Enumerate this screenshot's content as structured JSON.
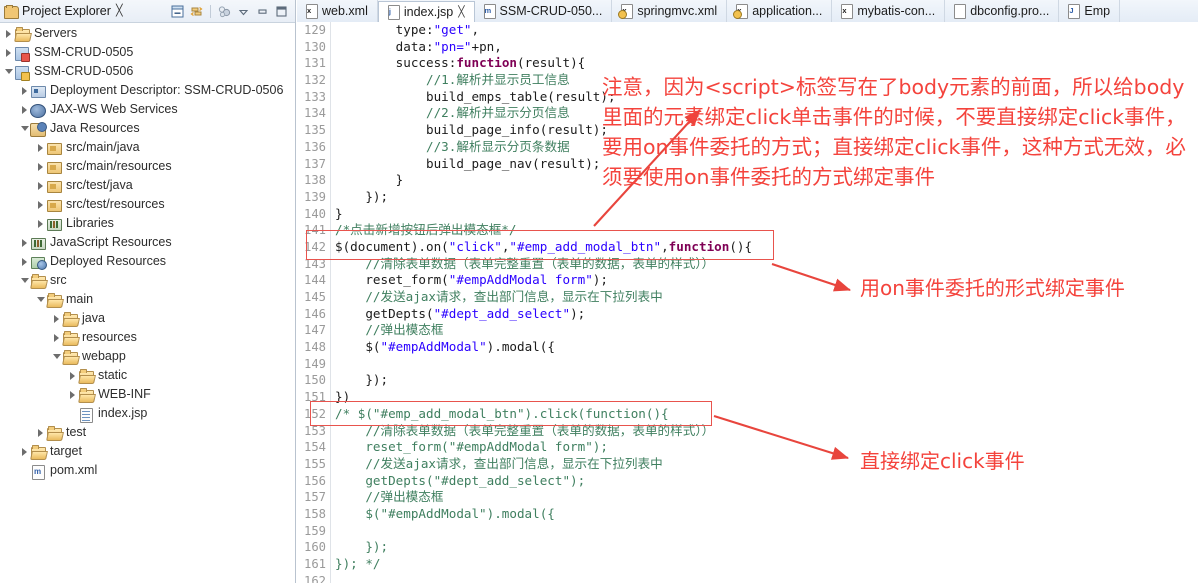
{
  "explorer": {
    "title": "Project Explorer",
    "close_glyph": "╳",
    "view_icon": "project-explorer-icon",
    "tools": [
      {
        "name": "collapse-all-icon",
        "label": "Collapse All"
      },
      {
        "name": "link-with-editor-icon",
        "label": "Link with Editor"
      },
      {
        "name": "focus-on-active-task-icon",
        "label": "Focus on Active Task"
      },
      {
        "name": "view-menu-icon",
        "label": "View Menu"
      },
      {
        "name": "minimize-icon",
        "label": "Minimize"
      },
      {
        "name": "maximize-icon",
        "label": "Maximize"
      }
    ],
    "tree": [
      {
        "label": "Servers",
        "indent": 0,
        "state": "closed",
        "icon": "folder-open-icon"
      },
      {
        "label": "SSM-CRUD-0505",
        "indent": 0,
        "state": "closed",
        "icon": "project-error-icon"
      },
      {
        "label": "SSM-CRUD-0506",
        "indent": 0,
        "state": "open",
        "icon": "project-warning-icon"
      },
      {
        "label": "Deployment Descriptor: SSM-CRUD-0506",
        "indent": 1,
        "state": "closed",
        "icon": "deployment-descriptor-icon"
      },
      {
        "label": "JAX-WS Web Services",
        "indent": 1,
        "state": "closed",
        "icon": "web-services-icon"
      },
      {
        "label": "Java Resources",
        "indent": 1,
        "state": "open",
        "icon": "java-resources-icon"
      },
      {
        "label": "src/main/java",
        "indent": 2,
        "state": "closed",
        "icon": "source-folder-icon"
      },
      {
        "label": "src/main/resources",
        "indent": 2,
        "state": "closed",
        "icon": "source-folder-icon"
      },
      {
        "label": "src/test/java",
        "indent": 2,
        "state": "closed",
        "icon": "source-folder-icon"
      },
      {
        "label": "src/test/resources",
        "indent": 2,
        "state": "closed",
        "icon": "source-folder-icon"
      },
      {
        "label": "Libraries",
        "indent": 2,
        "state": "closed",
        "icon": "libraries-icon"
      },
      {
        "label": "JavaScript Resources",
        "indent": 1,
        "state": "closed",
        "icon": "libraries-icon"
      },
      {
        "label": "Deployed Resources",
        "indent": 1,
        "state": "closed",
        "icon": "deployed-resources-icon"
      },
      {
        "label": "src",
        "indent": 1,
        "state": "open",
        "icon": "folder-open-icon"
      },
      {
        "label": "main",
        "indent": 2,
        "state": "open",
        "icon": "folder-open-icon"
      },
      {
        "label": "java",
        "indent": 3,
        "state": "closed",
        "icon": "folder-open-icon"
      },
      {
        "label": "resources",
        "indent": 3,
        "state": "closed",
        "icon": "folder-open-icon"
      },
      {
        "label": "webapp",
        "indent": 3,
        "state": "open",
        "icon": "folder-open-icon"
      },
      {
        "label": "static",
        "indent": 4,
        "state": "closed",
        "icon": "folder-open-icon"
      },
      {
        "label": "WEB-INF",
        "indent": 4,
        "state": "closed",
        "icon": "folder-open-icon"
      },
      {
        "label": "index.jsp",
        "indent": 4,
        "state": "leaf",
        "icon": "jsp-file-icon"
      },
      {
        "label": "test",
        "indent": 2,
        "state": "closed",
        "icon": "folder-open-icon"
      },
      {
        "label": "target",
        "indent": 1,
        "state": "closed",
        "icon": "folder-open-icon"
      },
      {
        "label": "pom.xml",
        "indent": 1,
        "state": "leaf",
        "icon": "maven-pom-icon"
      }
    ]
  },
  "editor": {
    "tabs": [
      {
        "label": "web.xml",
        "icon": "xml-file-icon",
        "badge": "x",
        "active": false,
        "closable": false,
        "warn": false
      },
      {
        "label": "index.jsp",
        "icon": "jsp-file-icon",
        "badge": "j",
        "active": true,
        "closable": true,
        "warn": false,
        "close_glyph": "╳"
      },
      {
        "label": "SSM-CRUD-050...",
        "icon": "maven-pom-icon",
        "badge": "m",
        "active": false,
        "closable": false,
        "warn": false
      },
      {
        "label": "springmvc.xml",
        "icon": "xml-file-icon",
        "badge": "x",
        "active": false,
        "closable": false,
        "warn": true
      },
      {
        "label": "application...",
        "icon": "xml-file-icon",
        "badge": "x",
        "active": false,
        "closable": false,
        "warn": true
      },
      {
        "label": "mybatis-con...",
        "icon": "xml-file-icon",
        "badge": "x",
        "active": false,
        "closable": false,
        "warn": false
      },
      {
        "label": "dbconfig.pro...",
        "icon": "properties-file-icon",
        "badge": "",
        "active": false,
        "closable": false,
        "warn": false
      },
      {
        "label": "Emp",
        "icon": "java-file-icon",
        "badge": "J",
        "active": false,
        "closable": false,
        "warn": false
      }
    ],
    "first_line_number": 129,
    "lines": [
      {
        "n": 129,
        "tokens": [
          {
            "t": "        type:",
            "c": "def"
          },
          {
            "t": "\"get\"",
            "c": "str"
          },
          {
            "t": ",",
            "c": "def"
          }
        ]
      },
      {
        "n": 130,
        "tokens": [
          {
            "t": "        data:",
            "c": "def"
          },
          {
            "t": "\"pn=\"",
            "c": "str"
          },
          {
            "t": "+pn,",
            "c": "def"
          }
        ]
      },
      {
        "n": 131,
        "tokens": [
          {
            "t": "        success:",
            "c": "def"
          },
          {
            "t": "function",
            "c": "kw"
          },
          {
            "t": "(result){",
            "c": "def"
          }
        ]
      },
      {
        "n": 132,
        "tokens": [
          {
            "t": "            //1.解析并显示员工信息",
            "c": "cmt"
          }
        ]
      },
      {
        "n": 133,
        "tokens": [
          {
            "t": "            build_emps_table(result);",
            "c": "def"
          }
        ]
      },
      {
        "n": 134,
        "tokens": [
          {
            "t": "            //2.解析并显示分页信息",
            "c": "cmt"
          }
        ]
      },
      {
        "n": 135,
        "tokens": [
          {
            "t": "            build_page_info(result);",
            "c": "def"
          }
        ]
      },
      {
        "n": 136,
        "tokens": [
          {
            "t": "            //3.解析显示分页条数据",
            "c": "cmt"
          }
        ]
      },
      {
        "n": 137,
        "tokens": [
          {
            "t": "            build_page_nav(result);",
            "c": "def"
          }
        ]
      },
      {
        "n": 138,
        "tokens": [
          {
            "t": "        }",
            "c": "def"
          }
        ]
      },
      {
        "n": 139,
        "tokens": [
          {
            "t": "    });",
            "c": "def"
          }
        ]
      },
      {
        "n": 140,
        "tokens": [
          {
            "t": "}",
            "c": "def"
          }
        ]
      },
      {
        "n": 141,
        "tokens": [
          {
            "t": "/*点击新增按钮后弹出模态框*/",
            "c": "cmt"
          }
        ]
      },
      {
        "n": 142,
        "tokens": [
          {
            "t": "$(document).on(",
            "c": "def"
          },
          {
            "t": "\"click\"",
            "c": "str"
          },
          {
            "t": ",",
            "c": "def"
          },
          {
            "t": "\"#emp_add_modal_btn\"",
            "c": "str"
          },
          {
            "t": ",",
            "c": "def"
          },
          {
            "t": "function",
            "c": "kw"
          },
          {
            "t": "(){",
            "c": "def"
          }
        ]
      },
      {
        "n": 143,
        "tokens": [
          {
            "t": "    //清除表单数据（表单完整重置（表单的数据，表单的样式））",
            "c": "cmt"
          }
        ]
      },
      {
        "n": 144,
        "tokens": [
          {
            "t": "    reset_form(",
            "c": "def"
          },
          {
            "t": "\"#empAddModal form\"",
            "c": "str"
          },
          {
            "t": ");",
            "c": "def"
          }
        ]
      },
      {
        "n": 145,
        "tokens": [
          {
            "t": "    //发送ajax请求，查出部门信息，显示在下拉列表中",
            "c": "cmt"
          }
        ]
      },
      {
        "n": 146,
        "tokens": [
          {
            "t": "    getDepts(",
            "c": "def"
          },
          {
            "t": "\"#dept_add_select\"",
            "c": "str"
          },
          {
            "t": ");",
            "c": "def"
          }
        ]
      },
      {
        "n": 147,
        "tokens": [
          {
            "t": "    //弹出模态框",
            "c": "cmt"
          }
        ]
      },
      {
        "n": 148,
        "tokens": [
          {
            "t": "    $(",
            "c": "def"
          },
          {
            "t": "\"#empAddModal\"",
            "c": "str"
          },
          {
            "t": ").modal({",
            "c": "def"
          }
        ]
      },
      {
        "n": 149,
        "tokens": [
          {
            "t": "",
            "c": "def"
          }
        ]
      },
      {
        "n": 150,
        "tokens": [
          {
            "t": "    });",
            "c": "def"
          }
        ]
      },
      {
        "n": 151,
        "tokens": [
          {
            "t": "})",
            "c": "def"
          }
        ]
      },
      {
        "n": 152,
        "tokens": [
          {
            "t": "/* $(\"#emp_add_modal_btn\").click(function(){",
            "c": "cmt"
          }
        ]
      },
      {
        "n": 153,
        "tokens": [
          {
            "t": "    //清除表单数据（表单完整重置（表单的数据，表单的样式））",
            "c": "cmt"
          }
        ]
      },
      {
        "n": 154,
        "tokens": [
          {
            "t": "    reset_form(\"#empAddModal form\");",
            "c": "cmt"
          }
        ]
      },
      {
        "n": 155,
        "tokens": [
          {
            "t": "    //发送ajax请求，查出部门信息，显示在下拉列表中",
            "c": "cmt"
          }
        ]
      },
      {
        "n": 156,
        "tokens": [
          {
            "t": "    getDepts(\"#dept_add_select\");",
            "c": "cmt"
          }
        ]
      },
      {
        "n": 157,
        "tokens": [
          {
            "t": "    //弹出模态框",
            "c": "cmt"
          }
        ]
      },
      {
        "n": 158,
        "tokens": [
          {
            "t": "    $(\"#empAddModal\").modal({",
            "c": "cmt"
          }
        ]
      },
      {
        "n": 159,
        "tokens": [
          {
            "t": "",
            "c": "cmt"
          }
        ]
      },
      {
        "n": 160,
        "tokens": [
          {
            "t": "    });",
            "c": "cmt"
          }
        ]
      },
      {
        "n": 161,
        "tokens": [
          {
            "t": "}); */",
            "c": "cmt"
          }
        ]
      },
      {
        "n": 162,
        "tokens": [
          {
            "t": "",
            "c": "def"
          }
        ]
      }
    ]
  },
  "annotations": {
    "color": "#f4433c",
    "main_note": "注意，因为<script>标签写在了body元素的前面，所以给body里面的元素绑定click单击事件的时候，不要直接绑定click事件，要用on事件委托的方式；直接绑定click事件，这种方式无效，必须要使用on事件委托的方式绑定事件",
    "note_on_delegate": "用on事件委托的形式绑定事件",
    "note_direct_click": "直接绑定click事件"
  }
}
